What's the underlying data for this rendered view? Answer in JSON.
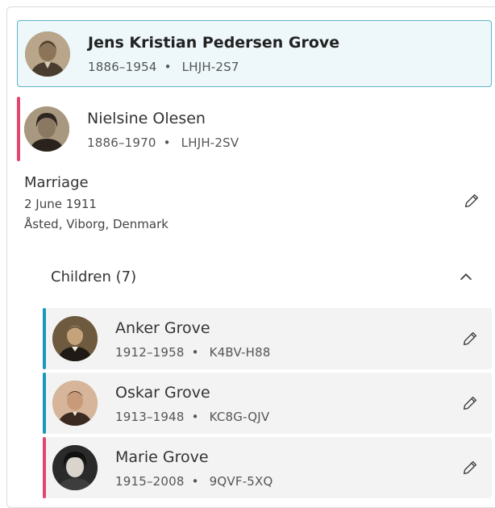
{
  "colors": {
    "male": "#1a98b9",
    "female": "#e2466f",
    "selected_bg": "#eef8fb",
    "selected_border": "#5fb3c7",
    "child_bg": "#f3f3f3"
  },
  "couple": {
    "husband": {
      "name": "Jens Kristian Pedersen Grove",
      "lifespan": "1886–1954",
      "id": "LHJH-2S7",
      "gender": "male"
    },
    "wife": {
      "name": "Nielsine Olesen",
      "lifespan": "1886–1970",
      "id": "LHJH-2SV",
      "gender": "female"
    }
  },
  "marriage": {
    "title": "Marriage",
    "date": "2 June 1911",
    "place": "Åsted, Viborg, Denmark",
    "edit_icon": "pencil-icon"
  },
  "children": {
    "label": "Children (7)",
    "toggle_icon": "chevron-up-icon",
    "items": [
      {
        "name": "Anker Grove",
        "lifespan": "1912–1958",
        "id": "K4BV-H88",
        "gender": "male",
        "edit_icon": "pencil-icon"
      },
      {
        "name": "Oskar Grove",
        "lifespan": "1913–1948",
        "id": "KC8G-QJV",
        "gender": "male",
        "edit_icon": "pencil-icon"
      },
      {
        "name": "Marie Grove",
        "lifespan": "1915–2008",
        "id": "9QVF-5XQ",
        "gender": "female",
        "edit_icon": "pencil-icon"
      }
    ]
  },
  "separator": "•"
}
